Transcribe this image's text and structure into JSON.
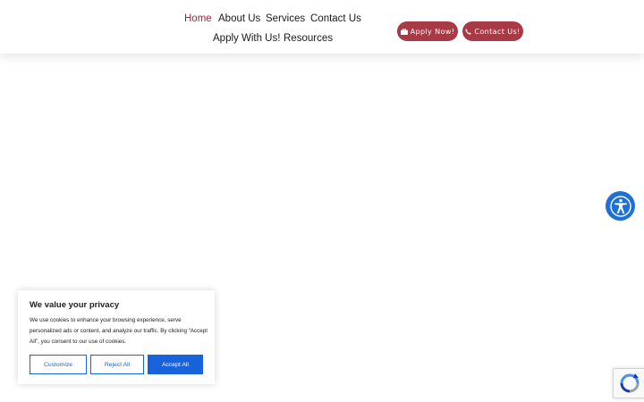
{
  "nav": {
    "home": "Home",
    "about": "About Us",
    "services": "Services",
    "contact": "Contact Us",
    "apply": "Apply With Us!",
    "resources": "Resources"
  },
  "cta": {
    "apply_now": "Apply Now!",
    "contact_us": "Contact Us!"
  },
  "cookie_banner": {
    "title": "We value your privacy",
    "text": "We use cookies to enhance your browsing experience, serve personalized ads or content, and analyze our traffic. By clicking “Accept All”, you consent to our use of cookies.",
    "customize": "Customize",
    "reject_all": "Reject All",
    "accept_all": "Accept All"
  },
  "colors": {
    "nav_active": "#a3262e",
    "cta_bg": "#a73a44",
    "accessibility_blue": "#1d70d6",
    "cookie_blue": "#1863dc"
  },
  "icons": {
    "apply": "briefcase-icon",
    "contact": "phone-icon",
    "accessibility": "accessibility-icon",
    "recaptcha": "recaptcha-icon"
  }
}
